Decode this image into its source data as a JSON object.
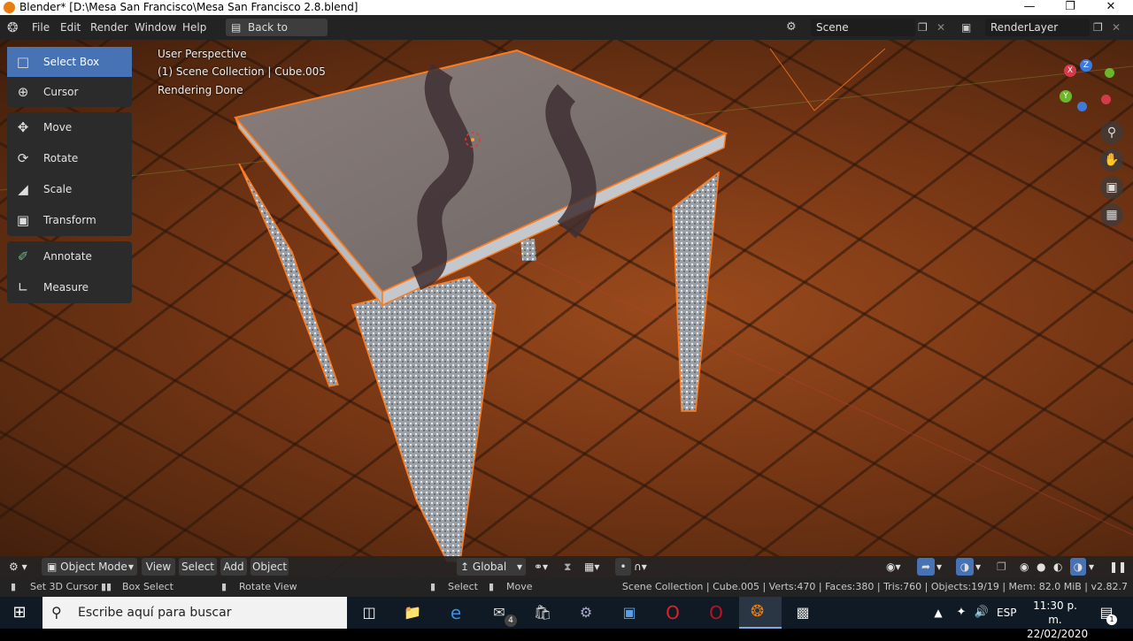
{
  "window": {
    "title": "Blender* [D:\\Mesa San Francisco\\Mesa San Francisco 2.8.blend]"
  },
  "menus": [
    "File",
    "Edit",
    "Render",
    "Window",
    "Help"
  ],
  "back_button": "Back to Previous",
  "scene_field": "Scene",
  "layer_field": "RenderLayer",
  "toolbar": {
    "select_box": "Select Box",
    "cursor": "Cursor",
    "move": "Move",
    "rotate": "Rotate",
    "scale": "Scale",
    "transform": "Transform",
    "annotate": "Annotate",
    "measure": "Measure"
  },
  "overlay": {
    "perspective": "User Perspective",
    "collection": "(1) Scene Collection | Cube.005",
    "status": "Rendering Done"
  },
  "gizmo": {
    "x": "X",
    "y": "Y",
    "z": "Z"
  },
  "header": {
    "mode": "Object Mode",
    "view": "View",
    "select": "Select",
    "add": "Add",
    "object": "Object",
    "orientation": "Global"
  },
  "statusbar": {
    "set_cursor": "Set 3D Cursor",
    "box_select": "Box Select",
    "rotate_view": "Rotate View",
    "select": "Select",
    "move": "Move",
    "stats": "Scene Collection | Cube.005 | Verts:470 | Faces:380 | Tris:760 | Objects:19/19 | Mem: 82.0 MiB | v2.82.7"
  },
  "taskbar": {
    "search_placeholder": "Escribe aquí para buscar",
    "mail_badge": "4",
    "lang": "ESP",
    "time": "11:30 p. m.",
    "date": "22/02/2020",
    "notif": "1"
  }
}
